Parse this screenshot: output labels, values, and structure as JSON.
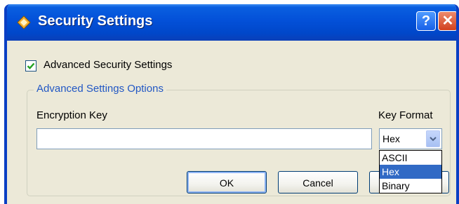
{
  "window": {
    "title": "Security Settings"
  },
  "titlebar_buttons": {
    "help_label": "?",
    "close_label": "✕"
  },
  "advanced_security": {
    "label": "Advanced Security Settings",
    "checked": true
  },
  "group": {
    "legend": "Advanced Settings Options"
  },
  "encryption_key": {
    "label": "Encryption Key",
    "value": ""
  },
  "key_format": {
    "label": "Key Format",
    "selected": "Hex",
    "options": [
      "ASCII",
      "Hex",
      "Binary"
    ]
  },
  "buttons": {
    "ok": "OK",
    "cancel": "Cancel"
  },
  "colors": {
    "titlebar": "#0350d8",
    "selection": "#316ac5",
    "legend_text": "#2157c4"
  }
}
